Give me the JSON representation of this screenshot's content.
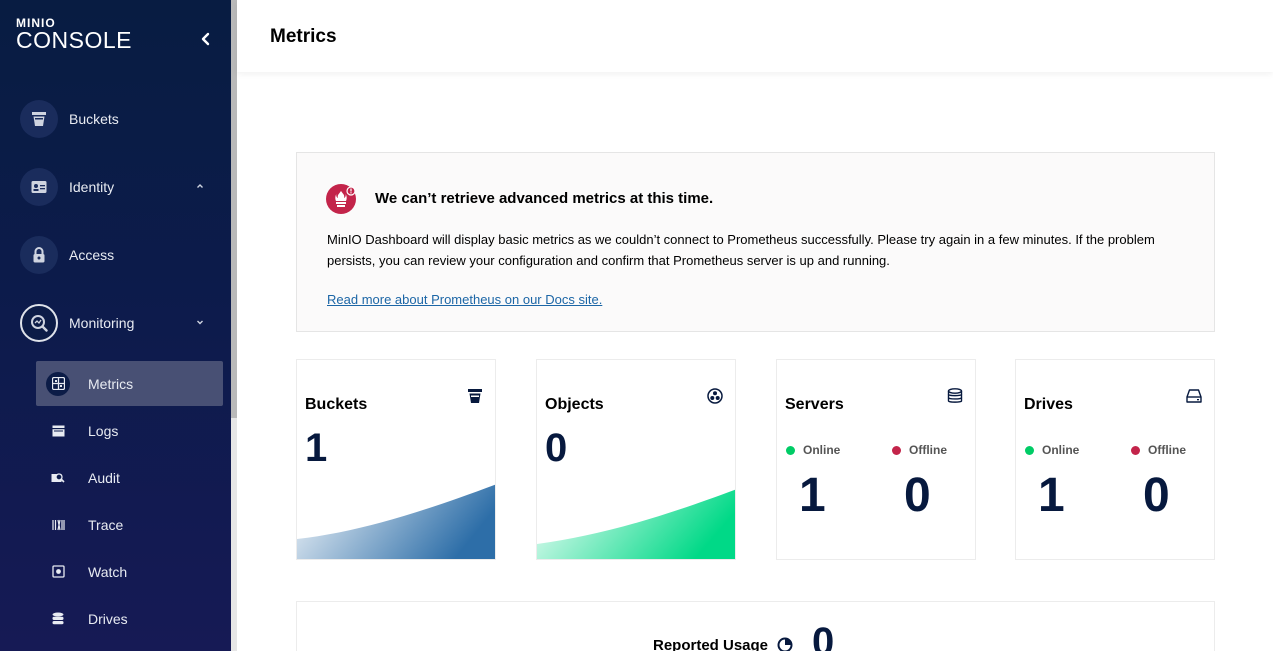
{
  "brand": {
    "top": "MINIO",
    "bottom": "CONSOLE"
  },
  "sidebar": {
    "items": [
      {
        "label": "Buckets",
        "icon": "bucket-icon"
      },
      {
        "label": "Identity",
        "icon": "id-card-icon"
      },
      {
        "label": "Access",
        "icon": "lock-icon"
      },
      {
        "label": "Monitoring",
        "icon": "monitoring-icon"
      }
    ],
    "sub_items": [
      {
        "label": "Metrics",
        "icon": "metrics-icon"
      },
      {
        "label": "Logs",
        "icon": "logs-icon"
      },
      {
        "label": "Audit",
        "icon": "audit-icon"
      },
      {
        "label": "Trace",
        "icon": "trace-icon"
      },
      {
        "label": "Watch",
        "icon": "watch-icon"
      },
      {
        "label": "Drives",
        "icon": "drives-icon"
      }
    ]
  },
  "header": {
    "title": "Metrics"
  },
  "alert": {
    "title": "We can’t retrieve advanced metrics at this time.",
    "body": "MinIO Dashboard will display basic metrics as we couldn’t connect to Prometheus successfully. Please try again in a few minutes. If the problem persists, you can review your configuration and confirm that Prometheus server is up and running.",
    "link": "Read more about Prometheus on our Docs site."
  },
  "cards": {
    "buckets": {
      "title": "Buckets",
      "value": "1"
    },
    "objects": {
      "title": "Objects",
      "value": "0"
    },
    "servers": {
      "title": "Servers",
      "online_label": "Online",
      "offline_label": "Offline",
      "online": "1",
      "offline": "0"
    },
    "drives": {
      "title": "Drives",
      "online_label": "Online",
      "offline_label": "Offline",
      "online": "1",
      "offline": "0"
    }
  },
  "usage": {
    "label": "Reported Usage",
    "value": "0"
  },
  "colors": {
    "online": "#00cc66",
    "offline": "#c3244a",
    "buckets_gradient": "#2d6ea8",
    "objects_gradient": "#00d987"
  }
}
